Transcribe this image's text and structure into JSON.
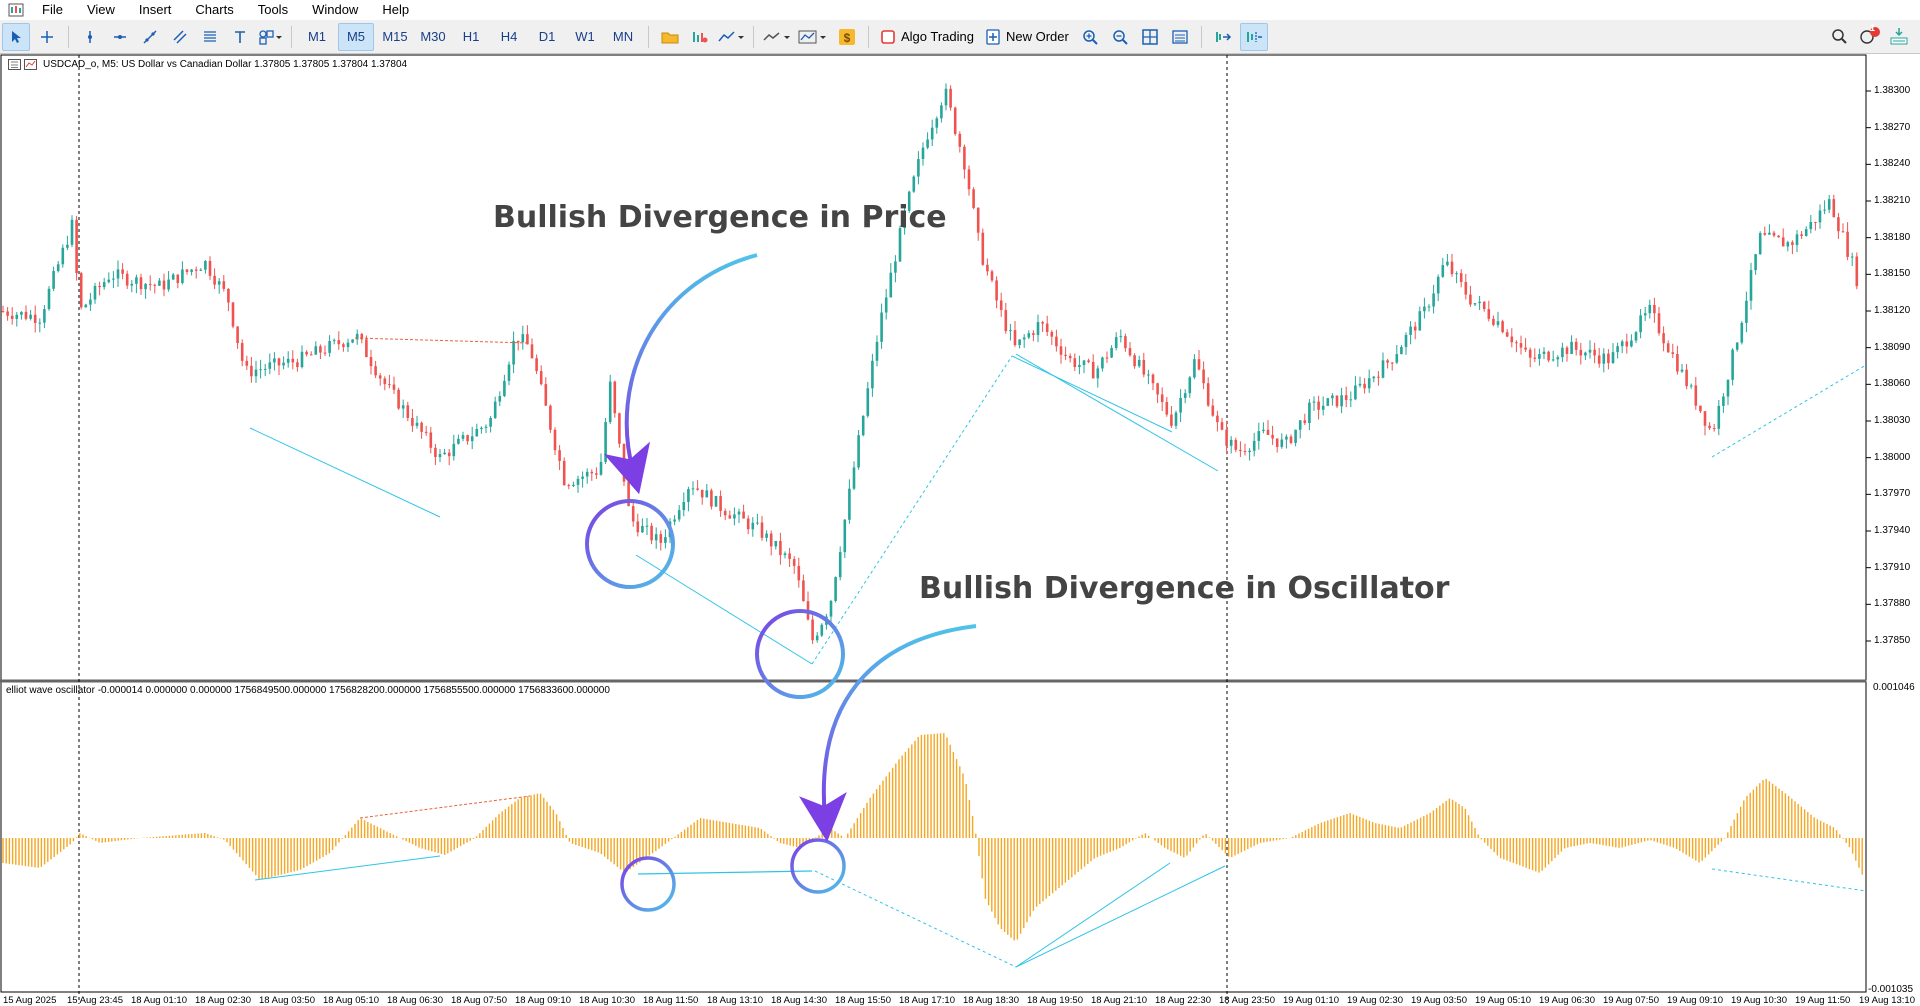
{
  "menu": {
    "items": [
      "File",
      "View",
      "Insert",
      "Charts",
      "Tools",
      "Window",
      "Help"
    ]
  },
  "toolbar": {
    "timeframes": [
      "M1",
      "M5",
      "M15",
      "M30",
      "H1",
      "H4",
      "D1",
      "W1",
      "MN"
    ],
    "active_timeframe": "M5",
    "algo_trading": "Algo Trading",
    "new_order": "New Order",
    "notification_count": "1"
  },
  "chart": {
    "title": "USDCAD_o, M5:  US Dollar vs Canadian Dollar  1.37805 1.37805 1.37804 1.37804",
    "oscillator_title": "elliot wave oscillator -0.000014 0.000000 0.000000 1756849500.000000 1756828200.000000 1756855500.000000 1756833600.000000",
    "price_labels": [
      "1.38300",
      "1.38270",
      "1.38240",
      "1.38210",
      "1.38180",
      "1.38150",
      "1.38120",
      "1.38090",
      "1.38060",
      "1.38030",
      "1.38000",
      "1.37970",
      "1.37940",
      "1.37910",
      "1.37880",
      "1.37850"
    ],
    "osc_max_label": "0.001046",
    "osc_min_label": "-0.001035",
    "time_labels": [
      "15 Aug 2025",
      "15 Aug 23:45",
      "18 Aug 01:10",
      "18 Aug 02:30",
      "18 Aug 03:50",
      "18 Aug 05:10",
      "18 Aug 06:30",
      "18 Aug 07:50",
      "18 Aug 09:10",
      "18 Aug 10:30",
      "18 Aug 11:50",
      "18 Aug 13:10",
      "18 Aug 14:30",
      "18 Aug 15:50",
      "18 Aug 17:10",
      "18 Aug 18:30",
      "18 Aug 19:50",
      "18 Aug 21:10",
      "18 Aug 22:30",
      "18 Aug 23:50",
      "19 Aug 01:10",
      "19 Aug 02:30",
      "19 Aug 03:50",
      "19 Aug 05:10",
      "19 Aug 06:30",
      "19 Aug 07:50",
      "19 Aug 09:10",
      "19 Aug 10:30",
      "19 Aug 11:50",
      "19 Aug 13:10"
    ],
    "annotation_price": "Bullish Divergence in Price",
    "annotation_osc": "Bullish Divergence in Oscillator",
    "colors": {
      "bull": "#26a69a",
      "bear": "#ef5350",
      "histogram": "#f5a623",
      "trendline": "#2ec4e6",
      "resistance": "#e8643a",
      "circle_a": "#7b3fe4",
      "circle_b": "#4fc3e8"
    }
  }
}
